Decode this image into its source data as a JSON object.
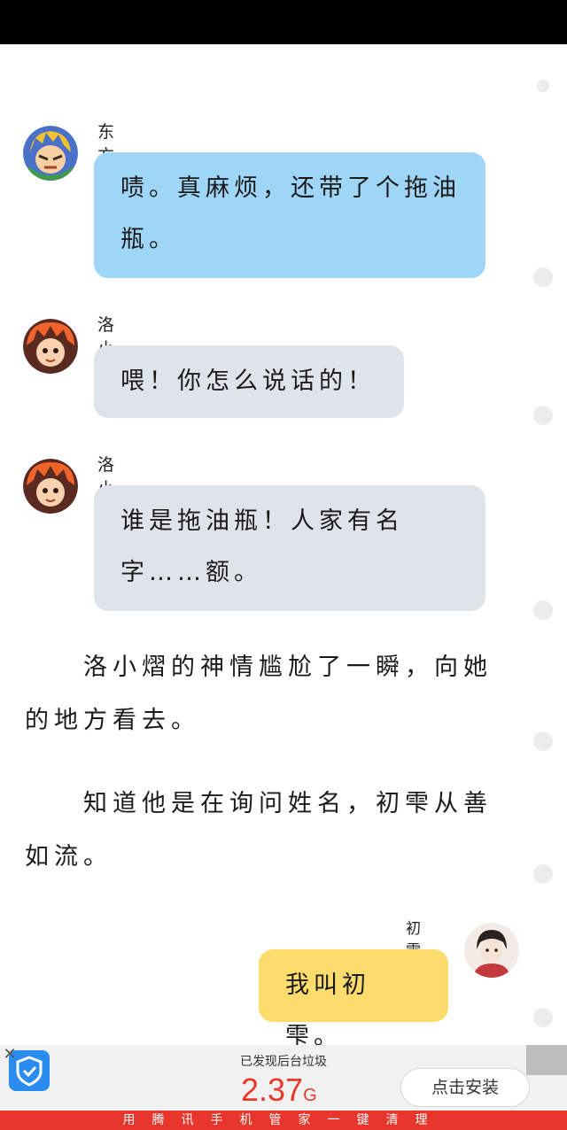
{
  "messages": [
    {
      "sender": "东方末",
      "text": "啧。真麻烦，还带了个拖油瓶。"
    },
    {
      "sender": "洛小熠",
      "text": "喂！你怎么说话的！"
    },
    {
      "sender": "洛小熠",
      "text": "谁是拖油瓶！人家有名字……额。"
    }
  ],
  "narration": [
    "洛小熠的神情尴尬了一瞬，向她的地方看去。",
    "知道他是在询问姓名，初雫从善如流。"
  ],
  "self_message": {
    "sender": "初雫",
    "text": "我叫初雫。"
  },
  "ad": {
    "close_glyph": "✕",
    "title": "已发现后台垃圾",
    "size_value": "2.37",
    "size_unit": "G",
    "install_label": "点击安装",
    "banner": "用腾讯手机管家一键清理"
  },
  "colors": {
    "bubble_blue": "#9fd6f7",
    "bubble_grey": "#dfe4ea",
    "bubble_yellow": "#fbdc6c",
    "ad_accent": "#e8392c"
  }
}
